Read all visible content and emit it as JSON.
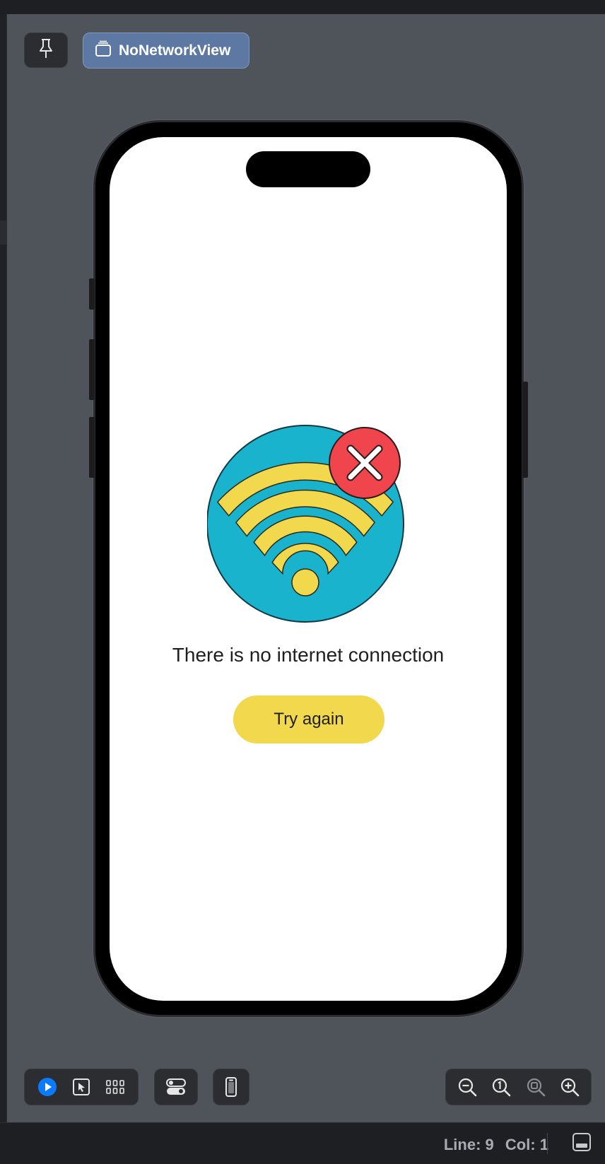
{
  "canvas": {
    "view_name": "NoNetworkView",
    "pin_icon": "pin-icon",
    "stack_icon": "stack-icon"
  },
  "screen": {
    "message": "There is no internet connection",
    "retry_label": "Try again",
    "illustration": "wifi-error-icon"
  },
  "colors": {
    "circle": "#1ab3cd",
    "wifi": "#f1d84c",
    "error": "#f0454c",
    "button": "#f1d84c",
    "accent": "#0a7aff"
  },
  "toolbar": {
    "mode_icons": [
      "play-icon",
      "select-icon",
      "grid-icon"
    ],
    "variants_icon": "toggles-icon",
    "device_icon": "device-icon",
    "zoom_icons": [
      "zoom-out-icon",
      "zoom-actual-icon",
      "zoom-fit-icon",
      "zoom-in-icon"
    ]
  },
  "status": {
    "line": "Line: 9",
    "col": "Col: 1"
  }
}
